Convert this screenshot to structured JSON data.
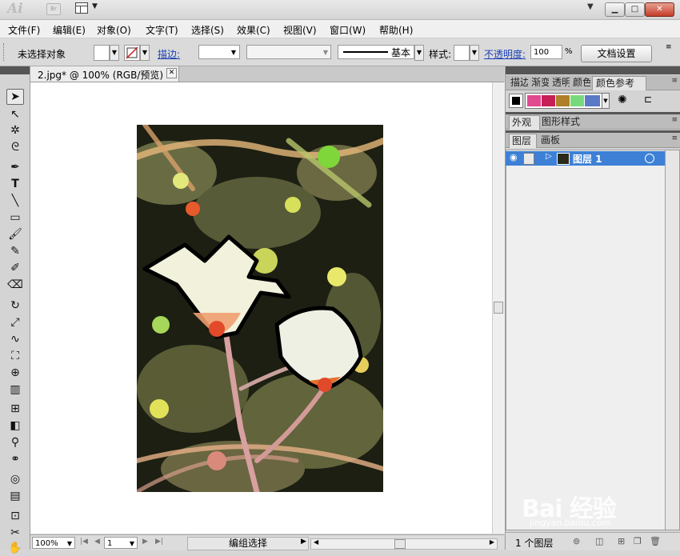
{
  "app": {
    "logo": "Ai",
    "bridge": "Br"
  },
  "window": {
    "min_icon": "▁",
    "max_icon": "□",
    "close_icon": "✕"
  },
  "menu": [
    "文件(F)",
    "编辑(E)",
    "对象(O)",
    "文字(T)",
    "选择(S)",
    "效果(C)",
    "视图(V)",
    "窗口(W)",
    "帮助(H)"
  ],
  "control_bar": {
    "selection_label": "未选择对象",
    "stroke_label": "描边:",
    "stroke_profile": "基本",
    "style_label": "样式:",
    "opacity_label": "不透明度:",
    "opacity_value": "100",
    "opacity_unit": "%",
    "doc_setup_button": "文档设置"
  },
  "document": {
    "tab_title": "2.jpg* @ 100% (RGB/预览)"
  },
  "status_bar": {
    "zoom": "100%",
    "artboard": "1",
    "status": "编组选择"
  },
  "panels": {
    "top_tabs": [
      "描边",
      "渐变",
      "透明",
      "颜色",
      "颜色参考"
    ],
    "swatch_colors": [
      "#e24a8f",
      "#c61f55",
      "#b07f2a",
      "#78d97c",
      "#5b79c5"
    ],
    "appearance_tabs": [
      "外观",
      "图形样式"
    ],
    "layer_tabs": [
      "图层",
      "画板"
    ],
    "layer_name": "图层 1",
    "layer_count": "1 个图层"
  },
  "tools": [
    "selection",
    "direct-selection",
    "magic-wand",
    "lasso",
    "pen",
    "type",
    "line",
    "rectangle",
    "paintbrush",
    "pencil",
    "blob-brush",
    "eraser",
    "rotate",
    "scale",
    "warp",
    "free-transform",
    "shape-builder",
    "perspective",
    "mesh",
    "gradient",
    "eyedropper",
    "blend",
    "symbol-sprayer",
    "column-graph",
    "artboard",
    "slice",
    "hand"
  ],
  "watermark": {
    "text": "Bai 经验",
    "url": "jingyan.baidu.com"
  }
}
